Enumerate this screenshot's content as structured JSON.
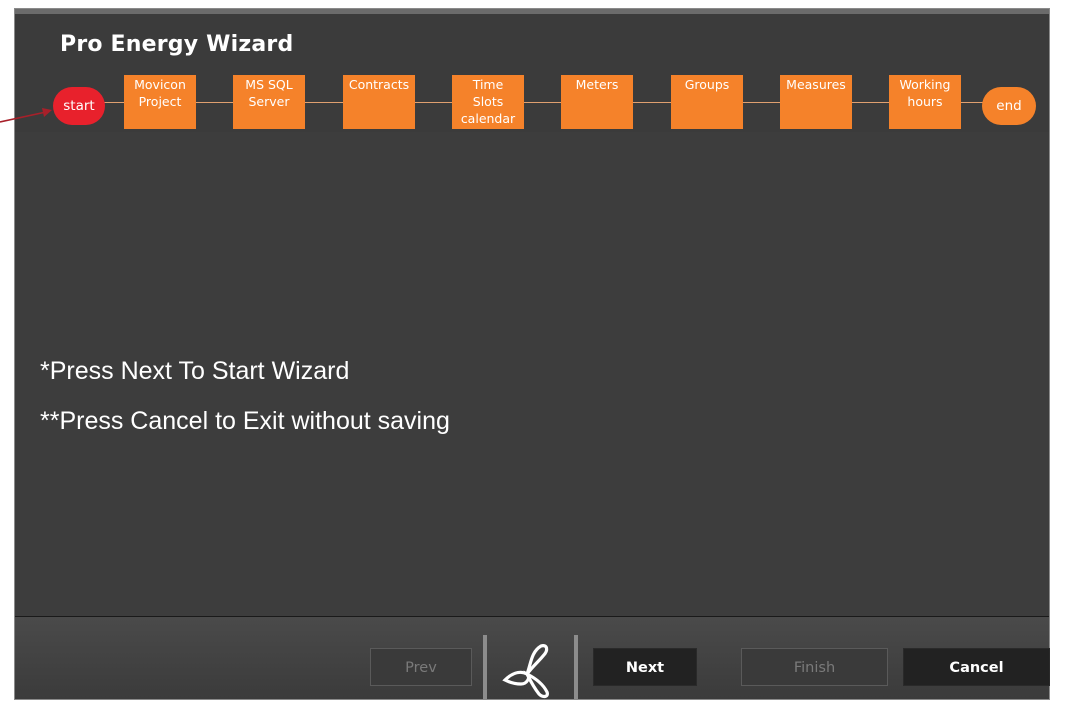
{
  "window": {
    "title": "Pro Energy Wizard"
  },
  "steps": {
    "start": "start",
    "end": "end",
    "items": [
      {
        "label": "Movicon\nProject"
      },
      {
        "label": "MS SQL\nServer"
      },
      {
        "label": "Contracts"
      },
      {
        "label": "Time\nSlots\ncalendar"
      },
      {
        "label": "Meters"
      },
      {
        "label": "Groups"
      },
      {
        "label": "Measures"
      },
      {
        "label": "Working\nhours"
      }
    ]
  },
  "content": {
    "line1": "*Press Next To Start Wizard",
    "line2": "**Press Cancel to Exit without saving"
  },
  "footer": {
    "prev_label": "Prev",
    "next_label": "Next",
    "finish_label": "Finish",
    "cancel_label": "Cancel"
  },
  "colors": {
    "step_box": "#f5822a",
    "start_circle": "#e8212c",
    "end_circle": "#f5822a",
    "background": "#3b3b3b",
    "annotation_arrow": "#a8202a"
  },
  "icons": {
    "logo": "wizard-logo-icon",
    "pointer": "annotation-arrow-icon"
  }
}
